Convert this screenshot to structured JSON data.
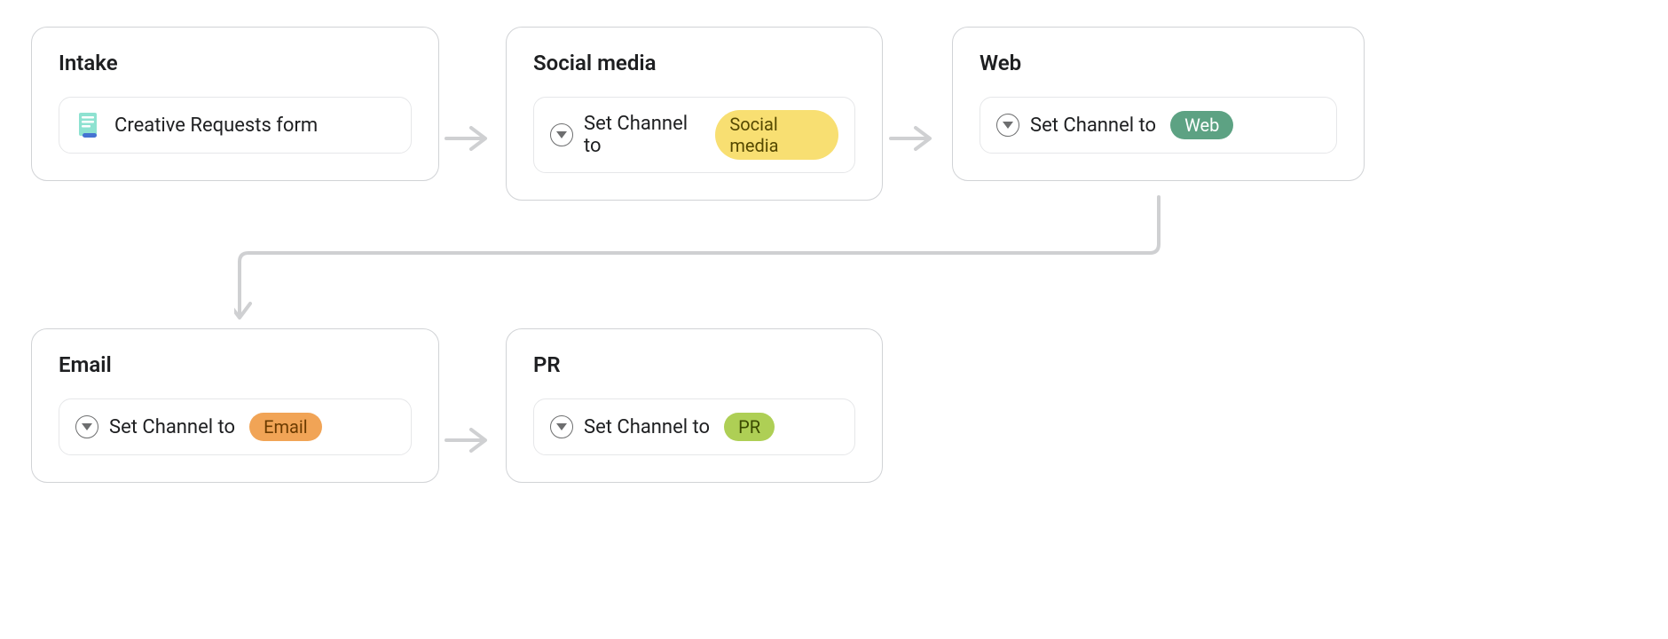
{
  "cards": {
    "intake": {
      "title": "Intake",
      "inner_text": "Creative Requests form"
    },
    "social": {
      "title": "Social media",
      "action_prefix": "Set Channel to",
      "chip_label": "Social media"
    },
    "web": {
      "title": "Web",
      "action_prefix": "Set Channel to",
      "chip_label": "Web"
    },
    "email": {
      "title": "Email",
      "action_prefix": "Set Channel to",
      "chip_label": "Email"
    },
    "pr": {
      "title": "PR",
      "action_prefix": "Set Channel to",
      "chip_label": "PR"
    }
  },
  "colors": {
    "border": "#d1d3d6",
    "inner_border": "#e6e7e9",
    "arrow": "#cfd0d2",
    "chip_yellow": "#f8df72",
    "chip_teal": "#5da283",
    "chip_orange": "#f1a456",
    "chip_green": "#aecf55"
  }
}
